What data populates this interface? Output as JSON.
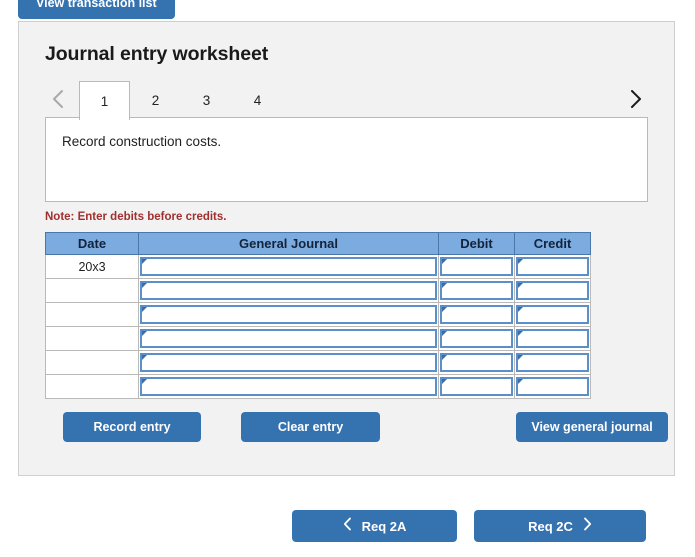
{
  "top_button": {
    "label": "View transaction list"
  },
  "panel": {
    "title": "Journal entry worksheet",
    "nav": {
      "prev_icon": "chevron-left-icon",
      "next_icon": "chevron-right-icon"
    },
    "tabs": [
      {
        "label": "1",
        "active": true
      },
      {
        "label": "2",
        "active": false
      },
      {
        "label": "3",
        "active": false
      },
      {
        "label": "4",
        "active": false
      }
    ],
    "description": "Record construction costs.",
    "note": "Note: Enter debits before credits.",
    "table": {
      "headers": [
        "Date",
        "General Journal",
        "Debit",
        "Credit"
      ],
      "rows": [
        {
          "date": "20x3",
          "general_journal": "",
          "debit": "",
          "credit": ""
        },
        {
          "date": "",
          "general_journal": "",
          "debit": "",
          "credit": ""
        },
        {
          "date": "",
          "general_journal": "",
          "debit": "",
          "credit": ""
        },
        {
          "date": "",
          "general_journal": "",
          "debit": "",
          "credit": ""
        },
        {
          "date": "",
          "general_journal": "",
          "debit": "",
          "credit": ""
        },
        {
          "date": "",
          "general_journal": "",
          "debit": "",
          "credit": ""
        }
      ]
    },
    "actions": {
      "record": "Record entry",
      "clear": "Clear entry",
      "view_general_journal": "View general journal"
    }
  },
  "req_nav": {
    "prev_label": "Req 2A",
    "prev_icon": "chevron-left-icon",
    "next_label": "Req 2C",
    "next_icon": "chevron-right-icon"
  },
  "colors": {
    "button_blue": "#3572b0",
    "header_blue": "#7cabe0",
    "cell_border_blue": "#5b8fc9",
    "note_red": "#a03030",
    "panel_bg": "#f2f2f2"
  }
}
